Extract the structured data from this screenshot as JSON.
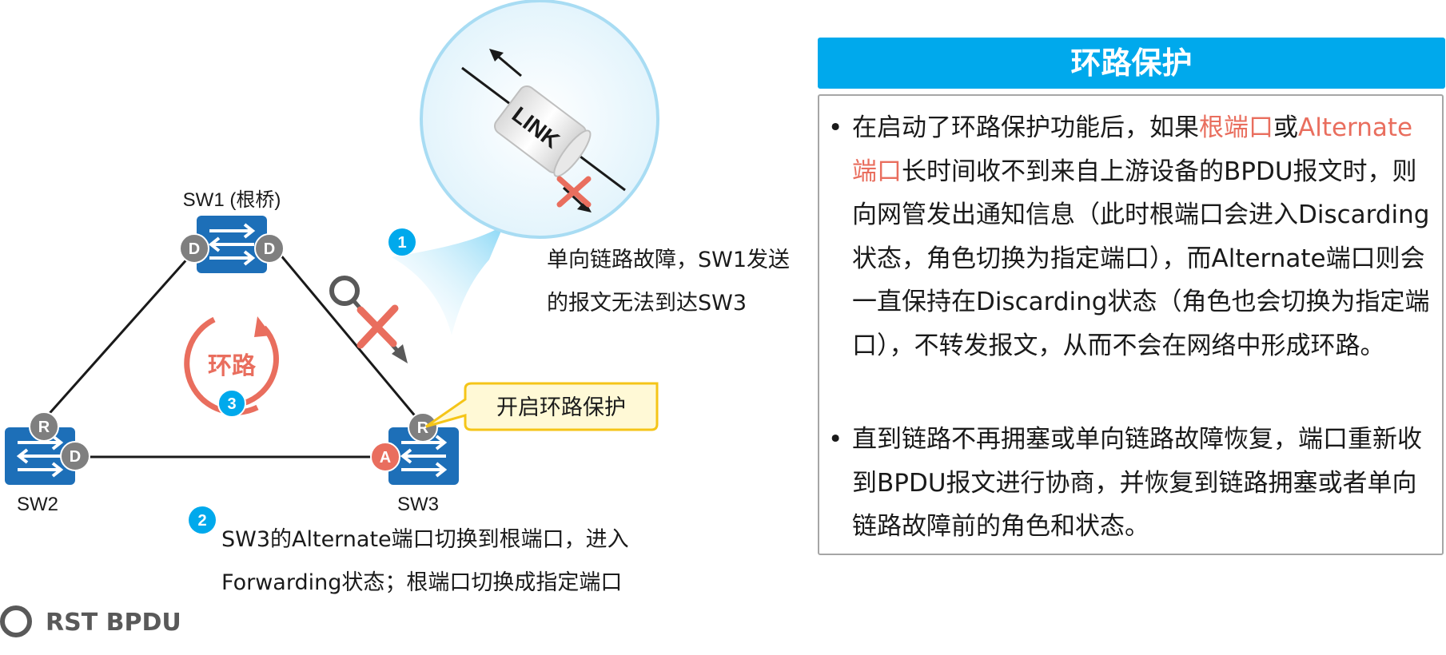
{
  "panel": {
    "title": "环路保护",
    "bullet1": {
      "seg1": "在启动了环路保护功能后，如果",
      "seg2": "根端口",
      "seg3": "或",
      "seg4": "Alternate端口",
      "seg5": "长时间收不到来自上游设备的BPDU报文时，则向网管发出通知信息（此时根端口会进入Discarding状态，角色切换为指定端口），而Alternate端口则会一直保持在Discarding状态（角色也会切换为指定端口），不转发报文，从而不会在网络中形成环路。"
    },
    "bullet2": "直到链路不再拥塞或单向链路故障恢复，端口重新收到BPDU报文进行协商，并恢复到链路拥塞或者单向链路故障前的角色和状态。"
  },
  "diagram": {
    "sw1_label": "SW1 (根桥)",
    "sw2_label": "SW2",
    "sw3_label": "SW3",
    "port_d": "D",
    "port_r": "R",
    "port_a": "A",
    "loop_label": "环路",
    "link_label": "LINK",
    "step1_num": "1",
    "step2_num": "2",
    "step3_num": "3",
    "step1_line1": "单向链路故障，SW1发送",
    "step1_line2": "的报文无法到达SW3",
    "step2_line1": "SW3的Alternate端口切换到根端口，进入",
    "step2_line2": "Forwarding状态；根端口切换成指定端口",
    "callout": "开启环路保护",
    "legend": "RST BPDU"
  },
  "colors": {
    "accent_blue": "#00a9ec",
    "switch_blue": "#1d6fb8",
    "highlight_red": "#e96e5e",
    "port_gray": "#7f7f7f",
    "callout_fill": "#fff9d6",
    "callout_border": "#f5c518"
  }
}
